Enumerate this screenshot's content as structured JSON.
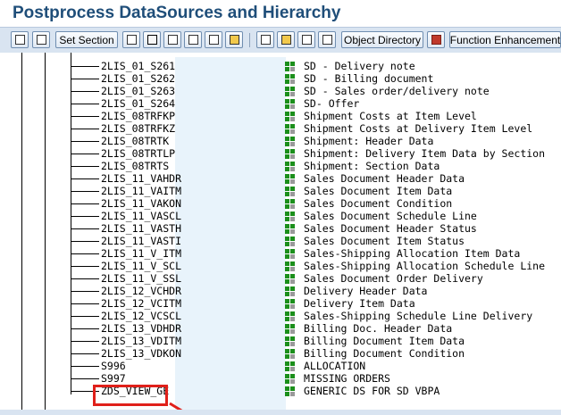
{
  "page": {
    "title": "Postprocess DataSources and Hierarchy"
  },
  "toolbar": {
    "set_section": "Set Section",
    "object_directory": "Object Directory",
    "function_enhancement": "Function Enhancement"
  },
  "tree": {
    "rows": [
      {
        "name": "2LIS_01_S261",
        "desc": "SD - Delivery note"
      },
      {
        "name": "2LIS_01_S262",
        "desc": "SD - Billing document"
      },
      {
        "name": "2LIS_01_S263",
        "desc": "SD - Sales order/delivery note"
      },
      {
        "name": "2LIS_01_S264",
        "desc": "SD- Offer"
      },
      {
        "name": "2LIS_08TRFKP",
        "desc": "Shipment Costs at Item Level"
      },
      {
        "name": "2LIS_08TRFKZ",
        "desc": "Shipment Costs at Delivery Item Level"
      },
      {
        "name": "2LIS_08TRTK",
        "desc": "Shipment: Header Data"
      },
      {
        "name": "2LIS_08TRTLP",
        "desc": "Shipment: Delivery Item Data by Section"
      },
      {
        "name": "2LIS_08TRTS",
        "desc": "Shipment: Section Data"
      },
      {
        "name": "2LIS_11_VAHDR",
        "desc": "Sales Document Header Data"
      },
      {
        "name": "2LIS_11_VAITM",
        "desc": "Sales Document Item Data"
      },
      {
        "name": "2LIS_11_VAKON",
        "desc": "Sales Document Condition"
      },
      {
        "name": "2LIS_11_VASCL",
        "desc": "Sales Document Schedule Line"
      },
      {
        "name": "2LIS_11_VASTH",
        "desc": "Sales Document Header Status"
      },
      {
        "name": "2LIS_11_VASTI",
        "desc": "Sales Document Item Status"
      },
      {
        "name": "2LIS_11_V_ITM",
        "desc": "Sales-Shipping Allocation Item Data"
      },
      {
        "name": "2LIS_11_V_SCL",
        "desc": "Sales-Shipping Allocation Schedule Line"
      },
      {
        "name": "2LIS_11_V_SSL",
        "desc": "Sales Document Order Delivery"
      },
      {
        "name": "2LIS_12_VCHDR",
        "desc": "Delivery Header Data"
      },
      {
        "name": "2LIS_12_VCITM",
        "desc": "Delivery Item Data"
      },
      {
        "name": "2LIS_12_VCSCL",
        "desc": "Sales-Shipping Schedule Line Delivery"
      },
      {
        "name": "2LIS_13_VDHDR",
        "desc": "Billing Doc. Header Data"
      },
      {
        "name": "2LIS_13_VDITM",
        "desc": "Billing Document Item Data"
      },
      {
        "name": "2LIS_13_VDKON",
        "desc": "Billing Document Condition"
      },
      {
        "name": "S996",
        "desc": "ALLOCATION"
      },
      {
        "name": "S997",
        "desc": "MISSING ORDERS"
      },
      {
        "name": "ZDS_VIEW_GE",
        "desc": "GENERIC DS FOR SD VBPA"
      }
    ]
  },
  "colors": {
    "title": "#1f4e79",
    "toolbar_bg": "#d9e4f1",
    "highlight_panel": "#e8f3fb",
    "datasource_icon": "#1b8f1b",
    "annotation": "#e0201a"
  }
}
